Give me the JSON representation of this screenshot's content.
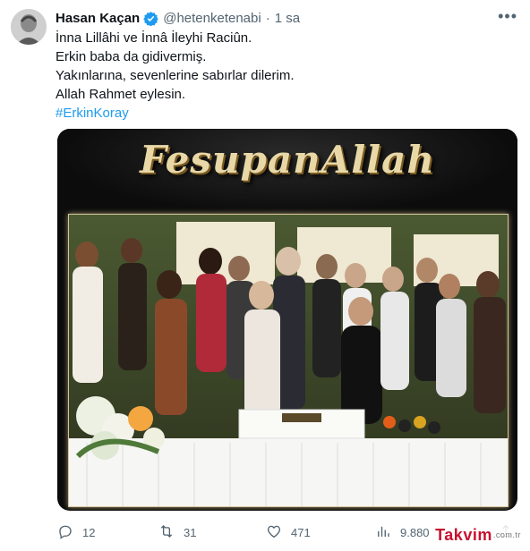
{
  "author": {
    "name": "Hasan Kaçan",
    "handle": "@hetenketenabi",
    "separator": "·",
    "time": "1 sa",
    "verified": true
  },
  "tweet": {
    "lines": [
      "İnna Lillâhi ve İnnâ İleyhi Raciûn.",
      "Erkin baba da gidivermiş.",
      "Yakınlarına, sevenlerine sabırlar dilerim.",
      "Allah Rahmet eylesin."
    ],
    "hashtag": "#ErkinKoray"
  },
  "media": {
    "banner_title": "FesupanAllah"
  },
  "actions": {
    "replies": "12",
    "retweets": "31",
    "likes": "471",
    "views": "9.880"
  },
  "watermark": {
    "brand": "Takvim",
    "suffix": ".com.tr"
  },
  "colors": {
    "accent": "#1d9bf0",
    "muted": "#536471",
    "text": "#0f1419",
    "watermark_red": "#c8102e"
  },
  "icons": [
    "verified-badge-icon",
    "more-options-icon",
    "reply-icon",
    "retweet-icon",
    "like-icon",
    "views-icon",
    "share-icon"
  ]
}
